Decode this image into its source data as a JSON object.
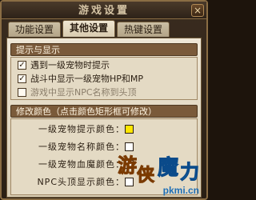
{
  "window": {
    "title": "游戏设置",
    "close_glyph": "×"
  },
  "tabs": [
    {
      "label": "功能设置",
      "active": false
    },
    {
      "label": "其他设置",
      "active": true
    },
    {
      "label": "热键设置",
      "active": false
    }
  ],
  "hints": {
    "header": "提示与显示",
    "options": [
      {
        "label": "遇到一级宠物时提示",
        "checked": true,
        "enabled": true
      },
      {
        "label": "战斗中显示一级宠物HP和MP",
        "checked": true,
        "enabled": true
      },
      {
        "label": "游戏中显示NPC名称到头顶",
        "checked": false,
        "enabled": false
      }
    ]
  },
  "colors": {
    "header": "修改颜色（点击颜色矩形框可修改）",
    "items": [
      {
        "label": "一级宠物提示颜色：",
        "color": "#ffe600"
      },
      {
        "label": "一级宠物名称颜色：",
        "color": "#ffffff"
      },
      {
        "label": "一级宠物血魔颜色：",
        "color": "#ffffff"
      },
      {
        "label": "NPC头顶显示颜色：",
        "color": "#ffffff"
      }
    ]
  },
  "watermark": {
    "text": "游侠魔力",
    "url": "pkmi.cn"
  },
  "icons": {
    "close": "close-icon",
    "check": "checkmark-icon"
  }
}
